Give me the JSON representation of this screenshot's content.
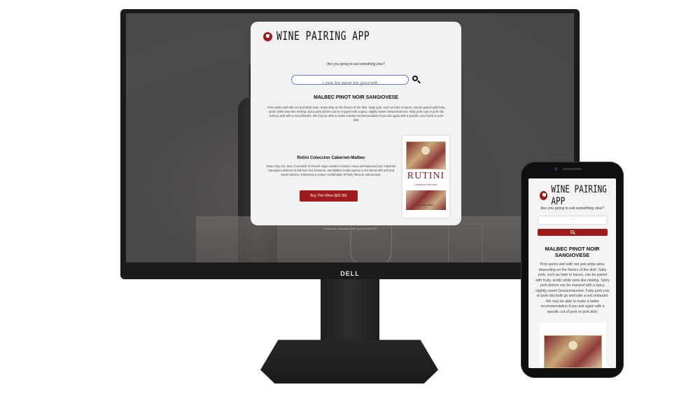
{
  "desktop": {
    "brand": "DELL",
    "app": {
      "title": "WINE PAIRING APP",
      "question": "Are you going to eat something else?",
      "search_placeholder": "Look for wine for yourself",
      "pairing_title": "MALBEC PINOT NOIR SANGIOVESE",
      "pairing_text": "Pork works well with red and white wine, depending on the flavors of the dish. Salty pork, such as ham or bacon, can be paired with fruity, acidic white wine like riesling. Spicy pork dishes can be enjoyed with a spicy, slightly sweet Gewurztraminer. Fatty pork cuts or pork ribs both go well with a red zinfandel. We may be able to make a better recommendation if you ask again with a specific cut of pork or pork dish.",
      "wine_name": "Rutini Coleccion Cabernet-Malbec",
      "wine_description": "Deep ruby red. Duo of varietals of French origin results in harmo- nious and balanced red. Cabernet Sauvignon delivers its full-bod- ied character, and Malbec lends nuance to the blend with soft and sweet tannins, enhancing a unique combination of fruity flavours and aromas.",
      "buy_label": "Buy This Wine ($22.99)",
      "label_brand": "RUTINI",
      "label_sub": "CABERNET-MALBEC",
      "label_footer": "RUTINI WINES",
      "footer": "Created for education with spoonacular API"
    }
  },
  "mobile": {
    "title": "WINE PAIRING APP",
    "question": "Are you going to eat something else?",
    "input_value": "'",
    "pairing_title": "MALBEC PINOT NOIR SANGIOVESE",
    "pairing_text": "Pork works well with red and white wine, depending on the flavors of the dish. Salty pork, such as ham or bacon, can be paired with fruity, acidic white wine like riesling. Spicy pork dishes can be enjoyed with a spicy, slightly sweet Gewurztraminer. Fatty pork cuts or pork ribs both go well with a red zinfandel. We may be able to make a better recommendation if you ask again with a specific cut of pork or pork dish."
  },
  "colors": {
    "accent": "#a01b1b",
    "card": "#f2f2f2",
    "search_border": "#5b7fd6"
  },
  "icons": [
    "wine-glass-logo-icon",
    "search-icon"
  ]
}
